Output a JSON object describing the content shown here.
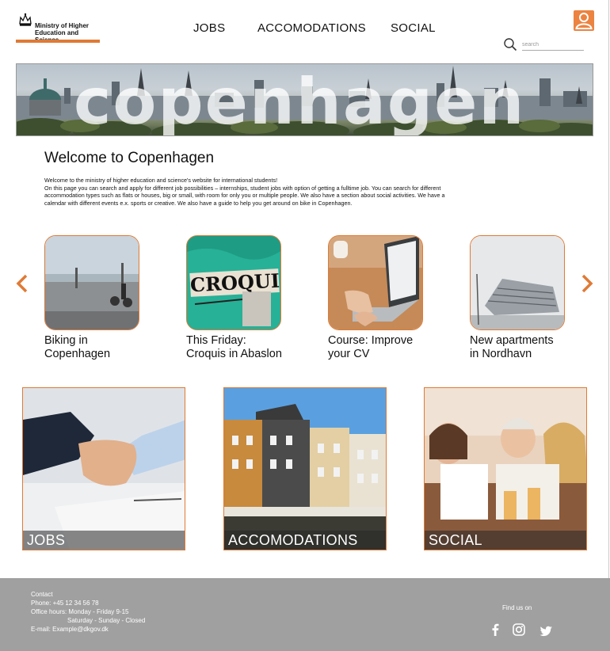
{
  "logo": {
    "name_line1": "Ministry of Higher",
    "name_line2": "Education and Science"
  },
  "nav": {
    "items": [
      "JOBS",
      "ACCOMODATIONS",
      "SOCIAL"
    ]
  },
  "search": {
    "placeholder": "search"
  },
  "hero": {
    "title": "copenhagen"
  },
  "welcome": {
    "title": "Welcome to Copenhagen",
    "lines": [
      "Welcome to the ministry of higher education and science's website for international students!",
      "On this page you can search and apply for different job possibilities – internships, student jobs with option of getting a fulltime job.  You can search for different accommodation types such as flats or houses, big or small, with room for only you or multiple people. We also have a section about social activities. We have a calendar with different events e.x. sports or creative. We also have a guide to help you get around on bike in Copenhagen."
    ]
  },
  "carousel": [
    {
      "line1": "Biking in",
      "line2": "Copenhagen"
    },
    {
      "line1": "This Friday:",
      "line2": "Croquis in Abaslon"
    },
    {
      "line1": "Course: Improve",
      "line2": "your CV"
    },
    {
      "line1": "New apartments",
      "line2": "in Nordhavn"
    }
  ],
  "croquis_art_text": "CROQUIS",
  "tiles": [
    "JOBS",
    "ACCOMODATIONS",
    "SOCIAL"
  ],
  "footer": {
    "contact_title": "Contact",
    "phone": "Phone: +45 12 34 56 78",
    "hours1": "Office hours: Monday - Friday 9-15",
    "hours2": "Saturday - Sunday - Closed",
    "email": "E-mail: Example@dkgov.dk",
    "find_us": "Find us on"
  },
  "colors": {
    "accent": "#e07a35",
    "footer_bg": "#a0a0a0",
    "user_button": "#ec8341"
  }
}
